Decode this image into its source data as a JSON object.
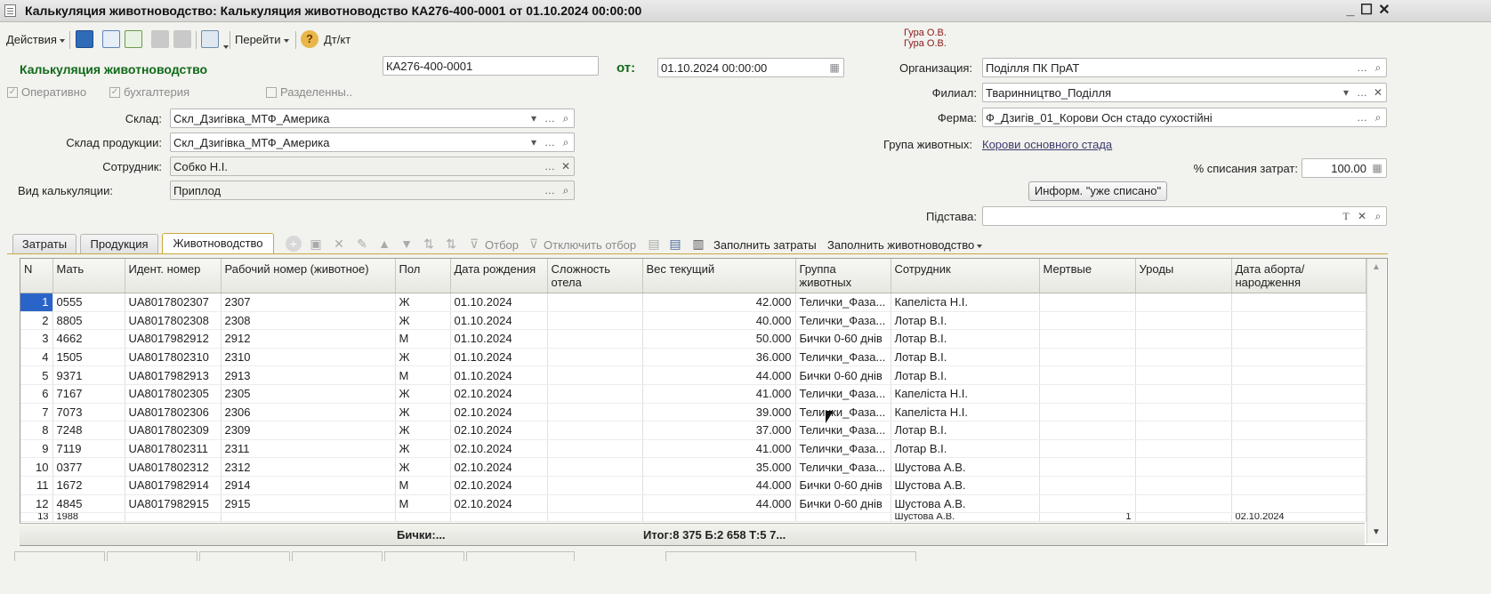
{
  "window": {
    "title": "Калькуляция животноводство: Калькуляция животноводство КА276-400-0001 от 01.10.2024 00:00:00"
  },
  "toolbar": {
    "actions_label": "Действия",
    "goto_label": "Перейти",
    "dtkt_label": "Дт/кт",
    "user_line1": "Гура О.В.",
    "user_line2": "Гура О.В."
  },
  "form": {
    "doc_type": "Калькуляция животноводство",
    "number": "КА276-400-0001",
    "from_label": "от:",
    "date": "01.10.2024 00:00:00",
    "operative_label": "Оперативно",
    "accounting_label": "бухгалтерия",
    "separated_label": "Разделенны..",
    "warehouse_label": "Склад:",
    "warehouse_value": "Скл_Дзигівка_МТФ_Америка",
    "product_warehouse_label": "Склад продукции:",
    "product_warehouse_value": "Скл_Дзигівка_МТФ_Америка",
    "employee_label": "Сотрудник:",
    "employee_value": "Собко Н.І.",
    "calc_type_label": "Вид калькуляции:",
    "calc_type_value": "Приплод",
    "org_label": "Организация:",
    "org_value": "Поділля ПК ПрАТ",
    "branch_label": "Филиал:",
    "branch_value": "Тваринництво_Поділля",
    "farm_label": "Ферма:",
    "farm_value": "Ф_Дзигів_01_Корови Осн стадо сухостійні",
    "animal_group_label": "Група животных:",
    "animal_group_value": "Корови основного стада",
    "writeoff_label": "% списания затрат:",
    "writeoff_value": "100.00",
    "info_button": "Информ. \"уже списано\"",
    "basis_label": "Підстава:"
  },
  "tabs": [
    "Затраты",
    "Продукция",
    "Животноводство"
  ],
  "table_toolbar": {
    "filter_label": "Отбор",
    "disable_filter_label": "Отключить отбор",
    "fill_costs_label": "Заполнить затраты",
    "fill_livestock_label": "Заполнить животноводство"
  },
  "grid": {
    "columns": [
      "N",
      "Мать",
      "Идент. номер",
      "Рабочий номер (животное)",
      "Пол",
      "Дата рождения",
      "Сложность отела",
      "Вес текущий",
      "Группа животных",
      "Сотрудник",
      "Мертвые",
      "Уроды",
      "Дата аборта/народження"
    ],
    "rows": [
      [
        "1",
        "0555",
        "UA8017802307",
        "2307",
        "Ж",
        "01.10.2024",
        "",
        "42.000",
        "Телички_Фаза...",
        "Капеліста Н.І.",
        "",
        "",
        ""
      ],
      [
        "2",
        "8805",
        "UA8017802308",
        "2308",
        "Ж",
        "01.10.2024",
        "",
        "40.000",
        "Телички_Фаза...",
        "Лотар В.І.",
        "",
        "",
        ""
      ],
      [
        "3",
        "4662",
        "UA8017982912",
        "2912",
        "М",
        "01.10.2024",
        "",
        "50.000",
        "Бички 0-60 днів",
        "Лотар В.І.",
        "",
        "",
        ""
      ],
      [
        "4",
        "1505",
        "UA8017802310",
        "2310",
        "Ж",
        "01.10.2024",
        "",
        "36.000",
        "Телички_Фаза...",
        "Лотар В.І.",
        "",
        "",
        ""
      ],
      [
        "5",
        "9371",
        "UA8017982913",
        "2913",
        "М",
        "01.10.2024",
        "",
        "44.000",
        "Бички 0-60 днів",
        "Лотар В.І.",
        "",
        "",
        ""
      ],
      [
        "6",
        "7167",
        "UA8017802305",
        "2305",
        "Ж",
        "02.10.2024",
        "",
        "41.000",
        "Телички_Фаза...",
        "Капеліста Н.І.",
        "",
        "",
        ""
      ],
      [
        "7",
        "7073",
        "UA8017802306",
        "2306",
        "Ж",
        "02.10.2024",
        "",
        "39.000",
        "Телички_Фаза...",
        "Капеліста Н.І.",
        "",
        "",
        ""
      ],
      [
        "8",
        "7248",
        "UA8017802309",
        "2309",
        "Ж",
        "02.10.2024",
        "",
        "37.000",
        "Телички_Фаза...",
        "Лотар В.І.",
        "",
        "",
        ""
      ],
      [
        "9",
        "7119",
        "UA8017802311",
        "2311",
        "Ж",
        "02.10.2024",
        "",
        "41.000",
        "Телички_Фаза...",
        "Лотар В.І.",
        "",
        "",
        ""
      ],
      [
        "10",
        "0377",
        "UA8017802312",
        "2312",
        "Ж",
        "02.10.2024",
        "",
        "35.000",
        "Телички_Фаза...",
        "Шустова А.В.",
        "",
        "",
        ""
      ],
      [
        "11",
        "1672",
        "UA8017982914",
        "2914",
        "М",
        "02.10.2024",
        "",
        "44.000",
        "Бички 0-60 днів",
        "Шустова А.В.",
        "",
        "",
        ""
      ],
      [
        "12",
        "4845",
        "UA8017982915",
        "2915",
        "М",
        "02.10.2024",
        "",
        "44.000",
        "Бички 0-60 днів",
        "Шустова А.В.",
        "",
        "",
        ""
      ],
      [
        "13",
        "1988",
        "",
        "",
        "",
        "",
        "",
        "",
        "",
        "Шустова А.В.",
        "1",
        "",
        "02.10.2024"
      ]
    ],
    "footer_sex": "Бички:...",
    "footer_weight": "Итог:8 375 Б:2 658 Т:5 7..."
  }
}
